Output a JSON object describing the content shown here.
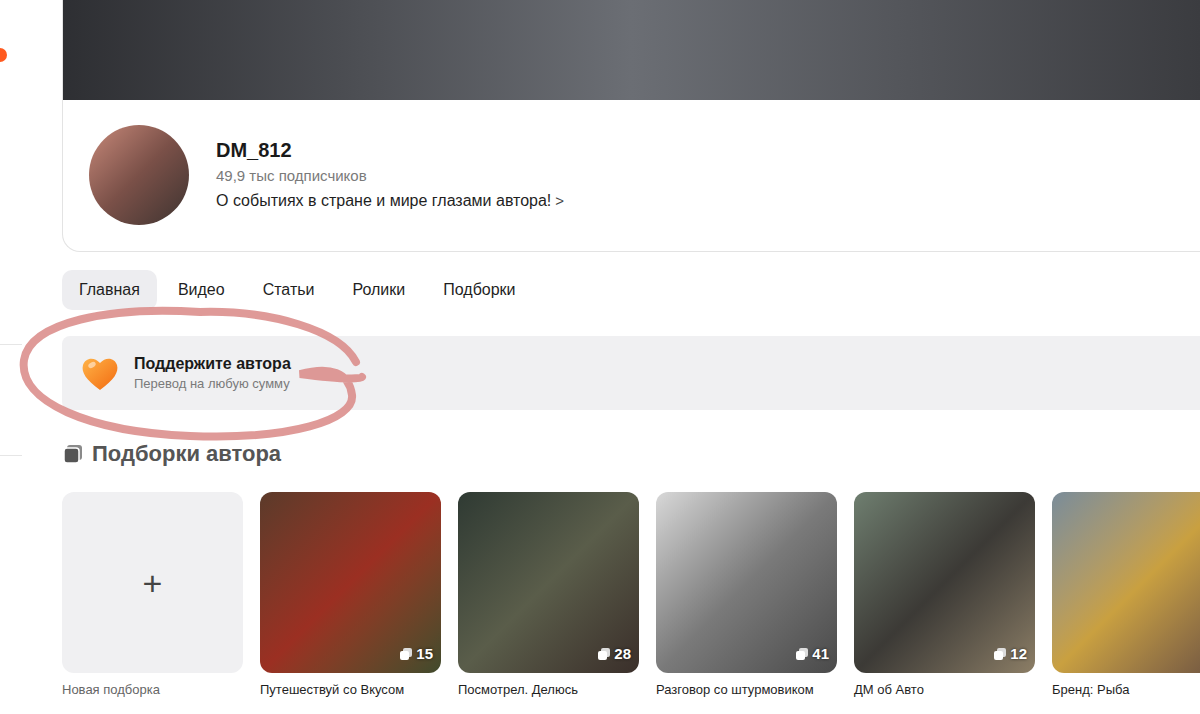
{
  "profile": {
    "name": "DM_812",
    "subscribers": "49,9 тыс подписчиков",
    "description": "О событиях в стране и мире глазами автора!",
    "description_chevron": ">"
  },
  "tabs": [
    {
      "label": "Главная",
      "selected": true
    },
    {
      "label": "Видео",
      "selected": false
    },
    {
      "label": "Статьи",
      "selected": false
    },
    {
      "label": "Ролики",
      "selected": false
    },
    {
      "label": "Подборки",
      "selected": false
    }
  ],
  "support": {
    "title": "Поддержите автора",
    "subtitle": "Перевод на любую сумму"
  },
  "collections": {
    "title": "Подборки автора",
    "new": {
      "icon": "+",
      "label": "Новая подборка"
    },
    "items": [
      {
        "label": "Путешествуй со Вкусом",
        "count": "15"
      },
      {
        "label": "Посмотрел. Делюсь",
        "count": "28"
      },
      {
        "label": "Разговор со штурмовиком",
        "count": "41"
      },
      {
        "label": "ДМ об Авто",
        "count": "12"
      },
      {
        "label": "Бренд: Рыба"
      }
    ]
  }
}
